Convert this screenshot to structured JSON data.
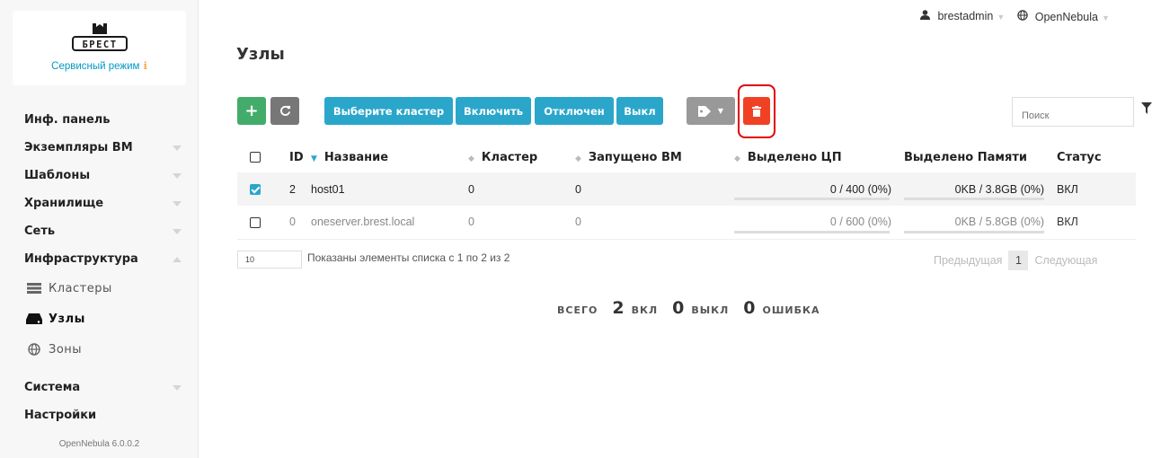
{
  "sidebar": {
    "logo_text": "БРЕСТ",
    "mode_label": "Сервисный режим",
    "items": [
      {
        "label": "Инф. панель"
      },
      {
        "label": "Экземпляры ВМ"
      },
      {
        "label": "Шаблоны"
      },
      {
        "label": "Хранилище"
      },
      {
        "label": "Сеть"
      },
      {
        "label": "Инфраструктура"
      }
    ],
    "sub_items": [
      {
        "label": "Кластеры",
        "icon": "server-stack-icon"
      },
      {
        "label": "Узлы",
        "icon": "hdd-icon"
      },
      {
        "label": "Зоны",
        "icon": "globe-icon"
      }
    ],
    "bottom_items": [
      {
        "label": "Система"
      },
      {
        "label": "Настройки"
      }
    ],
    "version": "OpenNebula 6.0.0.2"
  },
  "header": {
    "title": "Узлы",
    "user": "brestadmin",
    "zone": "OpenNebula"
  },
  "toolbar": {
    "add": "+",
    "select_cluster": "Выберите кластер",
    "enable": "Включить",
    "disabled": "Отключен",
    "off": "Выкл",
    "search_placeholder": "Поиск"
  },
  "table": {
    "columns": [
      "ID",
      "Название",
      "Кластер",
      "Запущено ВМ",
      "Выделено ЦП",
      "Выделено Памяти",
      "Статус"
    ],
    "rows": [
      {
        "checked": true,
        "id": "2",
        "name": "host01",
        "cluster": "0",
        "vms": "0",
        "cpu": "0 / 400 (0%)",
        "cpu_pct": 0,
        "mem": "0KB / 3.8GB (0%)",
        "mem_pct": 0,
        "status": "ВКЛ"
      },
      {
        "checked": false,
        "id": "0",
        "name": "oneserver.brest.local",
        "cluster": "0",
        "vms": "0",
        "cpu": "0 / 600 (0%)",
        "cpu_pct": 0,
        "mem": "0KB / 5.8GB (0%)",
        "mem_pct": 0,
        "status": "ВКЛ"
      }
    ]
  },
  "footer": {
    "page_size": "10",
    "info": "Показаны элементы списка с 1 по 2 из 2",
    "prev": "Предыдущая",
    "page": "1",
    "next": "Следующая"
  },
  "summary": {
    "total_label": "ВСЕГО",
    "on_value": "2",
    "on_label": "ВКЛ",
    "off_value": "0",
    "off_label": "ВЫКЛ",
    "error_value": "0",
    "error_label": "ОШИБКА"
  },
  "colors": {
    "accent": "#2ba6cb",
    "success": "#43ac6a",
    "danger": "#f04124",
    "highlight": "#e00000"
  }
}
